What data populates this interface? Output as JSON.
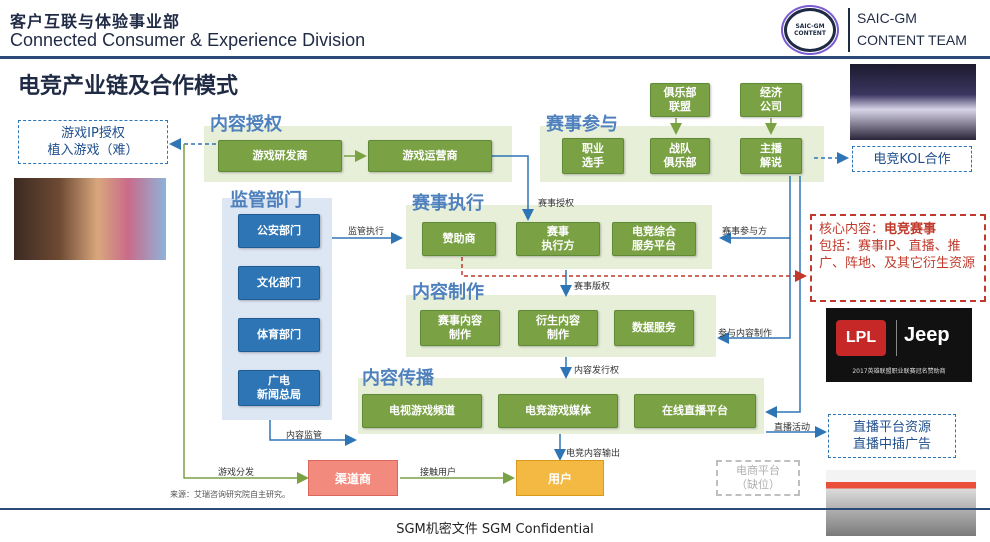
{
  "header": {
    "title_cn": "客户互联与体验事业部",
    "title_en": "Connected Consumer & Experience Division",
    "logo_text": "SAIC-GM CONTENT",
    "team_line1": "SAIC-GM",
    "team_line2": "CONTENT TEAM"
  },
  "page_title": "电竞产业链及合作模式",
  "regions": {
    "licensing": "内容授权",
    "participation": "赛事参与",
    "supervision": "监管部门",
    "execution": "赛事执行",
    "production": "内容制作",
    "distribution": "内容传播"
  },
  "nodes": {
    "game_dev": "游戏研发商",
    "game_op": "游戏运营商",
    "club_league": "俱乐部\n联盟",
    "economy_co": "经济\n公司",
    "pro_players": "职业\n选手",
    "team_club": "战队\n俱乐部",
    "host_commentary": "主播\n解说",
    "public_security": "公安部门",
    "culture": "文化部门",
    "sports": "体育部门",
    "radio_tv": "广电\n新闻总局",
    "sponsor": "赞助商",
    "event_exec": "赛事\n执行方",
    "esports_platform": "电竞综合\n服务平台",
    "event_content": "赛事内容\n制作",
    "derivative_content": "衍生内容\n制作",
    "data_service": "数据服务",
    "tv_channel": "电视游戏频道",
    "esports_media": "电竞游戏媒体",
    "live_platform": "在线直播平台",
    "channel_dealer": "渠道商",
    "user": "用户",
    "ecommerce": "电商平台\n（缺位）"
  },
  "labels": {
    "event_license": "赛事授权",
    "supervise_exec": "监管执行",
    "event_participate": "赛事参与方",
    "event_rights": "赛事版权",
    "participate_content": "参与内容制作",
    "content_issue": "内容发行权",
    "content_supervise": "内容监管",
    "live_activity": "直播活动",
    "game_distribution": "游戏分发",
    "reach_user": "接触用户",
    "esports_output": "电竞内容输出"
  },
  "callouts": {
    "game_ip": "游戏IP授权\n植入游戏（难）",
    "kol": "电竞KOL合作",
    "core_title_prefix": "核心内容：",
    "core_title_em": "电竞赛事",
    "core_body": "包括：赛事IP、直播、推广、阵地、及其它衍生资源",
    "live_resource": "直播平台资源\n直播中插广告"
  },
  "sponsor_img": {
    "left": "LPL",
    "right": "Jeep",
    "caption": "2017英雄联盟职业联赛冠名赞助商"
  },
  "source": "来源：艾瑞咨询研究院自主研究。",
  "footer": "SGM机密文件 SGM Confidential",
  "colors": {
    "green_region": "#e7efd8",
    "green_box": "#7aa245",
    "blue_box": "#2e75b6",
    "title_blue": "#4f81bd",
    "orange": "#f4b942",
    "pink": "#f28b7d",
    "red": "#c0392b"
  }
}
